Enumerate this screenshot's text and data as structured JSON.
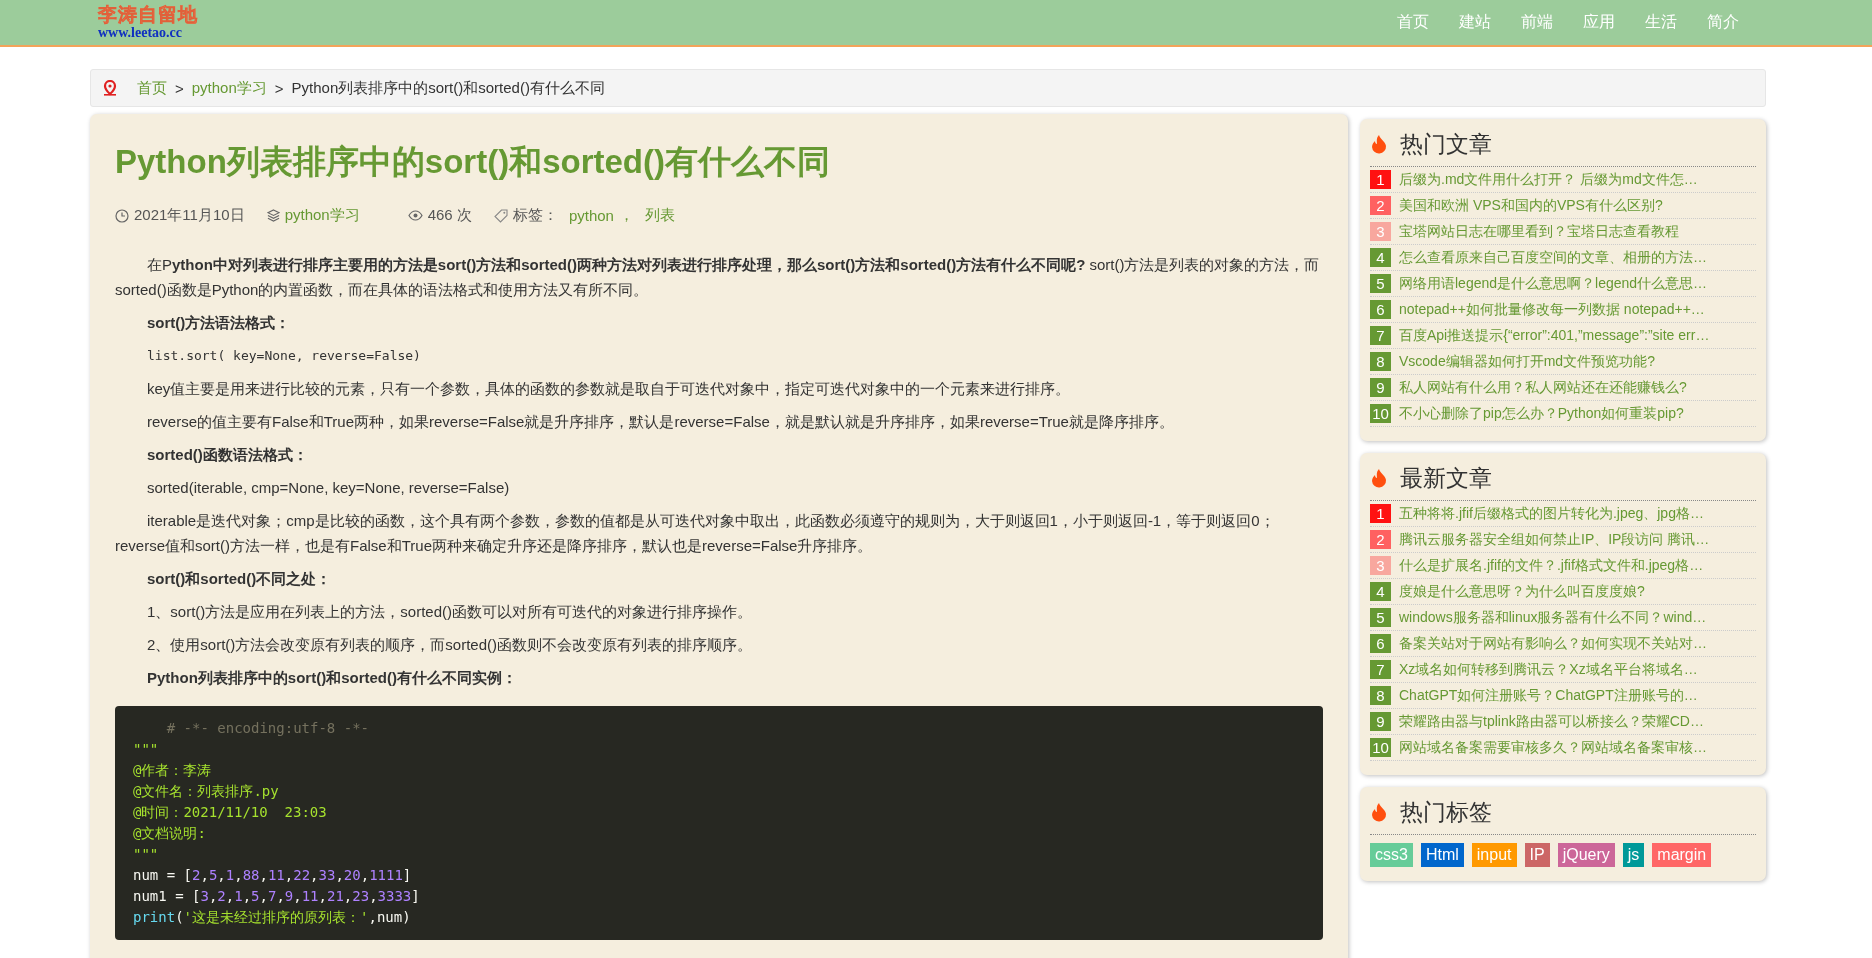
{
  "header": {
    "logo_title": "李涛自留地",
    "logo_url": "www.leetao.cc",
    "nav": [
      "首页",
      "建站",
      "前端",
      "应用",
      "生活",
      "简介"
    ]
  },
  "breadcrumb": {
    "links": [
      "首页",
      "python学习"
    ],
    "separator": ">",
    "current": "Python列表排序中的sort()和sorted()有什么不同"
  },
  "article": {
    "title": "Python列表排序中的sort()和sorted()有什么不同",
    "meta": {
      "date": "2021年11月10日",
      "category": "python学习",
      "views": "466 次",
      "tags_label": "标签：",
      "tags": [
        "python",
        "列表"
      ],
      "tag_separator": "，"
    },
    "paragraphs": [
      {
        "kind": "text",
        "text": "在P**ython中对列表进行排序主要用的方法是sort()方法和sorted()两种方法对列表进行排序处理，那么sort()方法和sorted()方法有什么不同呢?** sort()方法是列表的对象的方法，而sorted()函数是Python的内置函数，而在具体的语法格式和使用方法又有所不同。"
      },
      {
        "kind": "heading",
        "text": "sort()方法语法格式："
      },
      {
        "kind": "code",
        "text": "list.sort( key=None, reverse=False)"
      },
      {
        "kind": "text",
        "text": "key值主要是用来进行比较的元素，只有一个参数，具体的函数的参数就是取自于可迭代对象中，指定可迭代对象中的一个元素来进行排序。"
      },
      {
        "kind": "text",
        "text": "reverse的值主要有False和True两种，如果reverse=False就是升序排序，默认是reverse=False，就是默认就是升序排序，如果reverse=True就是降序排序。"
      },
      {
        "kind": "heading",
        "text": "sorted()函数语法格式："
      },
      {
        "kind": "text",
        "text": "sorted(iterable, cmp=None, key=None, reverse=False)"
      },
      {
        "kind": "text",
        "text": "iterable是迭代对象；cmp是比较的函数，这个具有两个参数，参数的值都是从可迭代对象中取出，此函数必须遵守的规则为，大于则返回1，小于则返回-1，等于则返回0；reverse值和sort()方法一样，也是有False和True两种来确定升序还是降序排序，默认也是reverse=False升序排序。"
      },
      {
        "kind": "heading",
        "text": "sort()和sorted()不同之处："
      },
      {
        "kind": "text",
        "text": "1、sort()方法是应用在列表上的方法，sorted()函数可以对所有可迭代的对象进行排序操作。"
      },
      {
        "kind": "text",
        "text": "2、使用sort()方法会改变原有列表的顺序，而sorted()函数则不会改变原有列表的排序顺序。"
      },
      {
        "kind": "heading",
        "text": "Python列表排序中的sort()和sorted()有什么不同实例："
      }
    ],
    "code": [
      [
        {
          "kind": "comment",
          "t": "    # -*- encoding:utf-8 -*-"
        }
      ],
      [
        {
          "kind": "string",
          "t": "\"\"\""
        }
      ],
      [
        {
          "kind": "string",
          "t": "@作者：李涛"
        }
      ],
      [
        {
          "kind": "string",
          "t": "@文件名：列表排序.py"
        }
      ],
      [
        {
          "kind": "string",
          "t": "@时间：2021/11/10  23:03"
        }
      ],
      [
        {
          "kind": "string",
          "t": "@文档说明:"
        }
      ],
      [
        {
          "kind": "string",
          "t": "\"\"\""
        }
      ],
      [
        {
          "kind": "plain",
          "t": "num = ["
        },
        {
          "kind": "number",
          "t": "2"
        },
        {
          "kind": "plain",
          "t": ","
        },
        {
          "kind": "number",
          "t": "5"
        },
        {
          "kind": "plain",
          "t": ","
        },
        {
          "kind": "number",
          "t": "1"
        },
        {
          "kind": "plain",
          "t": ","
        },
        {
          "kind": "number",
          "t": "88"
        },
        {
          "kind": "plain",
          "t": ","
        },
        {
          "kind": "number",
          "t": "11"
        },
        {
          "kind": "plain",
          "t": ","
        },
        {
          "kind": "number",
          "t": "22"
        },
        {
          "kind": "plain",
          "t": ","
        },
        {
          "kind": "number",
          "t": "33"
        },
        {
          "kind": "plain",
          "t": ","
        },
        {
          "kind": "number",
          "t": "20"
        },
        {
          "kind": "plain",
          "t": ","
        },
        {
          "kind": "number",
          "t": "1111"
        },
        {
          "kind": "plain",
          "t": "]"
        }
      ],
      [
        {
          "kind": "plain",
          "t": "num1 = ["
        },
        {
          "kind": "number",
          "t": "3"
        },
        {
          "kind": "plain",
          "t": ","
        },
        {
          "kind": "number",
          "t": "2"
        },
        {
          "kind": "plain",
          "t": ","
        },
        {
          "kind": "number",
          "t": "1"
        },
        {
          "kind": "plain",
          "t": ","
        },
        {
          "kind": "number",
          "t": "5"
        },
        {
          "kind": "plain",
          "t": ","
        },
        {
          "kind": "number",
          "t": "7"
        },
        {
          "kind": "plain",
          "t": ","
        },
        {
          "kind": "number",
          "t": "9"
        },
        {
          "kind": "plain",
          "t": ","
        },
        {
          "kind": "number",
          "t": "11"
        },
        {
          "kind": "plain",
          "t": ","
        },
        {
          "kind": "number",
          "t": "21"
        },
        {
          "kind": "plain",
          "t": ","
        },
        {
          "kind": "number",
          "t": "23"
        },
        {
          "kind": "plain",
          "t": ","
        },
        {
          "kind": "number",
          "t": "3333"
        },
        {
          "kind": "plain",
          "t": "]"
        }
      ],
      [
        {
          "kind": "builtin",
          "t": "print"
        },
        {
          "kind": "plain",
          "t": "("
        },
        {
          "kind": "string",
          "t": "'这是未经过排序的原列表：'"
        },
        {
          "kind": "plain",
          "t": ",num)"
        }
      ]
    ]
  },
  "sidebar": [
    {
      "kind": "list",
      "title": "热门文章",
      "items": [
        {
          "num": "1",
          "color": "#ff1111",
          "text": "后缀为.md文件用什么打开？ 后缀为md文件怎…"
        },
        {
          "num": "2",
          "color": "#ff6161",
          "text": "美国和欧洲 VPS和国内的VPS有什么区别?"
        },
        {
          "num": "3",
          "color": "#f8a79e",
          "text": "宝塔网站日志在哪里看到？宝塔日志查看教程"
        },
        {
          "num": "4",
          "color": "#669933",
          "text": "怎么查看原来自己百度空间的文章、相册的方法…"
        },
        {
          "num": "5",
          "color": "#669933",
          "text": "网络用语legend是什么意思啊？legend什么意思…"
        },
        {
          "num": "6",
          "color": "#669933",
          "text": "notepad++如何批量修改每一列数据 notepad++…"
        },
        {
          "num": "7",
          "color": "#669933",
          "text": "百度Api推送提示{“error”:401,”message”:”site err…"
        },
        {
          "num": "8",
          "color": "#669933",
          "text": "Vscode编辑器如何打开md文件预览功能?"
        },
        {
          "num": "9",
          "color": "#669933",
          "text": "私人网站有什么用？私人网站还在还能赚钱么?"
        },
        {
          "num": "10",
          "color": "#669933",
          "text": "不小心删除了pip怎么办？Python如何重装pip?"
        }
      ]
    },
    {
      "kind": "list",
      "title": "最新文章",
      "items": [
        {
          "num": "1",
          "color": "#ff1111",
          "text": "五种将将.jfif后缀格式的图片转化为.jpeg、jpg格…"
        },
        {
          "num": "2",
          "color": "#ff6161",
          "text": "腾讯云服务器安全组如何禁止IP、IP段访问 腾讯…"
        },
        {
          "num": "3",
          "color": "#f8a79e",
          "text": "什么是扩展名.jfif的文件？.jfif格式文件和.jpeg格…"
        },
        {
          "num": "4",
          "color": "#669933",
          "text": "度娘是什么意思呀？为什么叫百度度娘?"
        },
        {
          "num": "5",
          "color": "#669933",
          "text": "windows服务器和linux服务器有什么不同？wind…"
        },
        {
          "num": "6",
          "color": "#669933",
          "text": "备案关站对于网站有影响么？如何实现不关站对…"
        },
        {
          "num": "7",
          "color": "#669933",
          "text": "Xz域名如何转移到腾讯云？Xz域名平台将域名…"
        },
        {
          "num": "8",
          "color": "#669933",
          "text": "ChatGPT如何注册账号？ChatGPT注册账号的…"
        },
        {
          "num": "9",
          "color": "#669933",
          "text": "荣耀路由器与tplink路由器可以桥接么？荣耀CD…"
        },
        {
          "num": "10",
          "color": "#669933",
          "text": "网站域名备案需要审核多久？网站域名备案审核…"
        }
      ]
    },
    {
      "kind": "tags",
      "title": "热门标签",
      "tags": [
        {
          "label": "css3",
          "color": "#66cc99"
        },
        {
          "label": "Html",
          "color": "#0066cc"
        },
        {
          "label": "input",
          "color": "#ff9900"
        },
        {
          "label": "IP",
          "color": "#cc6666"
        },
        {
          "label": "jQuery",
          "color": "#cc6699"
        },
        {
          "label": "js",
          "color": "#009999"
        },
        {
          "label": "margin",
          "color": "#ff6666"
        }
      ]
    }
  ]
}
